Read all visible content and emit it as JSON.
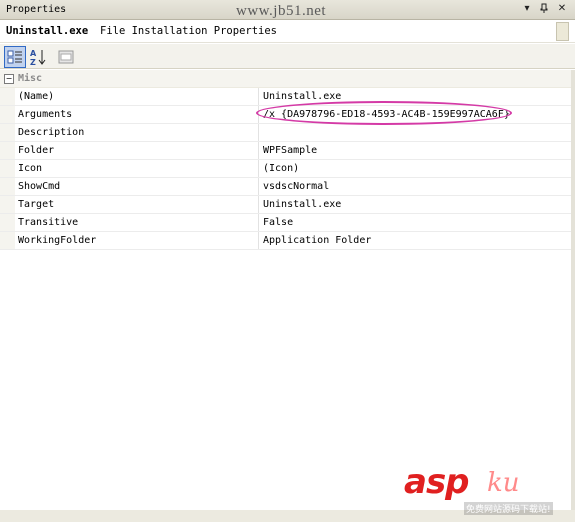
{
  "window": {
    "title": "Properties",
    "watermark_site": "www.jb51.net"
  },
  "object_selector": {
    "name": "Uninstall.exe",
    "description": "File Installation Properties"
  },
  "grid": {
    "category": "Misc",
    "properties": [
      {
        "name": "(Name)",
        "value": "Uninstall.exe"
      },
      {
        "name": "Arguments",
        "value": "/x {DA978796-ED18-4593-AC4B-159E997ACA6F}"
      },
      {
        "name": "Description",
        "value": ""
      },
      {
        "name": "Folder",
        "value": "WPFSample"
      },
      {
        "name": "Icon",
        "value": "(Icon)"
      },
      {
        "name": "ShowCmd",
        "value": "vsdscNormal"
      },
      {
        "name": "Target",
        "value": "Uninstall.exe"
      },
      {
        "name": "Transitive",
        "value": "False"
      },
      {
        "name": "WorkingFolder",
        "value": "Application Folder"
      }
    ]
  },
  "logo": {
    "brand_main": "asp",
    "brand_sub": "ku",
    "tagline": "免费网站源码下载站!"
  },
  "colors": {
    "highlight": "#d43aa6",
    "toolbar_active": "#c1d2ee",
    "logo_red": "#e02020"
  },
  "icons": [
    "categorized-icon",
    "alphabetical-icon",
    "property-pages-icon",
    "dropdown-arrow-icon",
    "pin-icon",
    "close-icon",
    "collapse-icon"
  ]
}
